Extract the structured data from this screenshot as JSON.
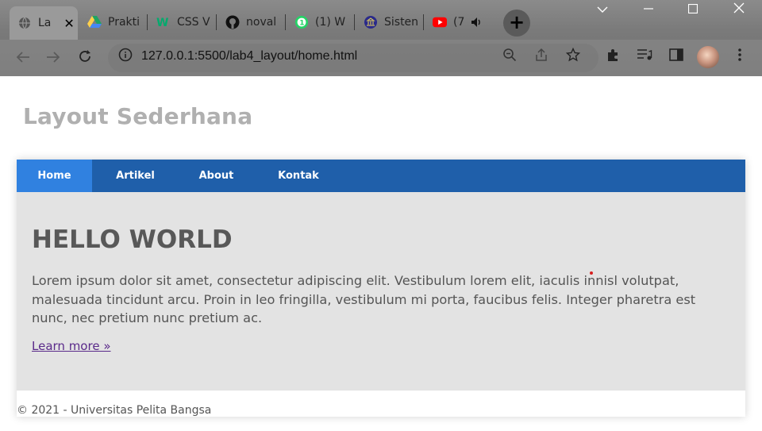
{
  "browser": {
    "tabs": [
      {
        "title": "La",
        "icon": "globe-icon",
        "active": true
      },
      {
        "title": "Prakti",
        "icon": "google-drive-icon"
      },
      {
        "title": "CSS V",
        "icon": "w3schools-icon"
      },
      {
        "title": "noval",
        "icon": "github-icon"
      },
      {
        "title": "(1) W",
        "icon": "whatsapp-icon",
        "badge": "1"
      },
      {
        "title": "Sisten",
        "icon": "university-icon"
      },
      {
        "title": "(7",
        "icon": "youtube-icon"
      }
    ],
    "new_tab_label": "+",
    "url": "127.0.0.1:5500/lab4_layout/home.html"
  },
  "page": {
    "site_title": "Layout Sederhana",
    "nav": [
      {
        "label": "Home",
        "active": true
      },
      {
        "label": "Artikel"
      },
      {
        "label": "About"
      },
      {
        "label": "Kontak"
      }
    ],
    "hero": {
      "title": "HELLO WORLD",
      "text": "Lorem ipsum dolor sit amet, consectetur adipiscing elit. Vestibulum lorem elit, iaculis innisl volutpat, malesuada tincidunt arcu. Proin in leo fringilla, vestibulum mi porta, faucibus felis. Integer pharetra est nunc, nec pretium nunc pretium ac.",
      "link": "Learn more »"
    },
    "footer": "© 2021 - Universitas Pelita Bangsa"
  },
  "colors": {
    "nav_bg": "#1f5faa",
    "nav_active": "#3081e0",
    "hero_bg": "#e3e3e3",
    "title_gray": "#b0b0b0"
  }
}
